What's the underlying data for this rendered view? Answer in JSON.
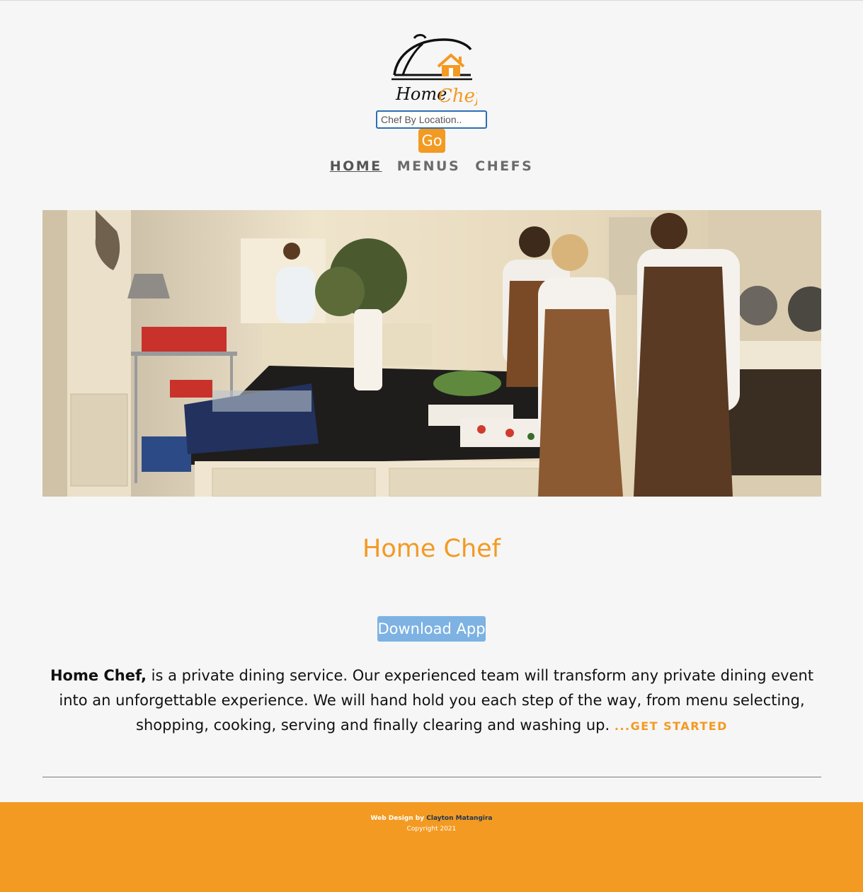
{
  "header": {
    "logo_text_home": "Home",
    "logo_text_chef": "Chef",
    "search": {
      "placeholder": "Chef By Location.."
    },
    "go_label": "Go"
  },
  "nav": {
    "items": [
      {
        "label": "HOME",
        "active": true
      },
      {
        "label": "MENUS",
        "active": false
      },
      {
        "label": "CHEFS",
        "active": false
      }
    ]
  },
  "main": {
    "title": "Home Chef",
    "download_label": "Download App",
    "blurb_strong": "Home Chef,",
    "blurb_text": " is a private dining service. Our experienced team will transform any private dining event into an unforgettable experience. We will hand hold you each step of the way, from menu selecting, shopping, cooking, serving and finally clearing and washing up. ",
    "get_started": "...GET STARTED"
  },
  "footer": {
    "credit_prefix": "Web Design by ",
    "credit_name": "Clayton Matangira",
    "copyright": "Copyright 2021"
  },
  "colors": {
    "accent": "#f39a22",
    "download_button": "#7db2e3",
    "footer_link": "#1f3558"
  }
}
